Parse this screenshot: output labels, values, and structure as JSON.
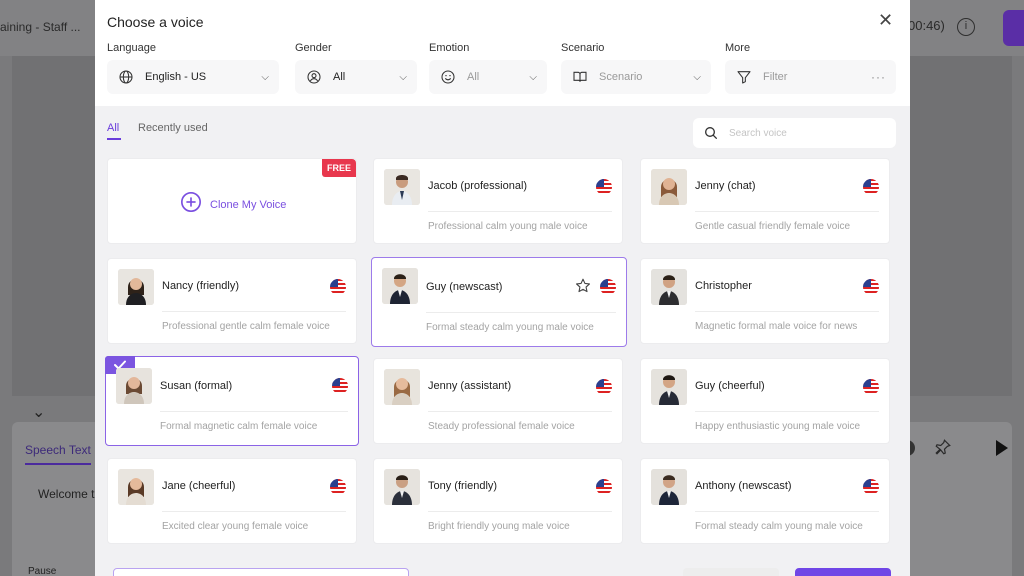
{
  "background": {
    "project_title": "aining - Staff ...",
    "timer": "00:46)",
    "info_glyph": "i",
    "panel_tab": "Speech Text",
    "speech_preview": "Welcome t",
    "bottom_left": "Pause"
  },
  "modal": {
    "title": "Choose a voice",
    "close_glyph": "✕",
    "filters": {
      "language": {
        "label": "Language",
        "value": "English - US"
      },
      "gender": {
        "label": "Gender",
        "value": "All"
      },
      "emotion": {
        "label": "Emotion",
        "value": "All"
      },
      "scenario": {
        "label": "Scenario",
        "value": "Scenario"
      },
      "more": {
        "label": "More",
        "value": "Filter"
      }
    },
    "tabs": {
      "all": "All",
      "recent": "Recently used"
    },
    "search_placeholder": "Search voice",
    "clone": {
      "label": "Clone My Voice",
      "badge": "FREE"
    },
    "voices": [
      {
        "name": "Jacob (professional)",
        "desc": "Professional calm young male voice"
      },
      {
        "name": "Jenny (chat)",
        "desc": "Gentle casual friendly female voice"
      },
      {
        "name": "Nancy (friendly)",
        "desc": "Professional gentle calm female voice"
      },
      {
        "name": "Guy (newscast)",
        "desc": "Formal steady calm young male voice"
      },
      {
        "name": "Christopher",
        "desc": "Magnetic formal male voice for news"
      },
      {
        "name": "Susan (formal)",
        "desc": "Formal magnetic calm female voice"
      },
      {
        "name": "Jenny (assistant)",
        "desc": "Steady professional female voice"
      },
      {
        "name": "Guy (cheerful)",
        "desc": "Happy enthusiastic young male voice"
      },
      {
        "name": "Jane (cheerful)",
        "desc": "Excited clear young female voice"
      },
      {
        "name": "Tony (friendly)",
        "desc": "Bright friendly young male voice"
      },
      {
        "name": "Anthony (newscast)",
        "desc": "Formal steady calm young male voice"
      }
    ]
  },
  "colors": {
    "accent": "#6a3ddb",
    "free_badge": "#e8374d",
    "overlay": "#7a7a7c"
  },
  "icons": {
    "language": "globe-icon",
    "gender": "person-icon",
    "emotion": "smiley-icon",
    "scenario": "book-icon",
    "more": "filter-icon",
    "flag": "us-flag-icon",
    "favorite": "star-icon",
    "selected": "check-icon"
  }
}
